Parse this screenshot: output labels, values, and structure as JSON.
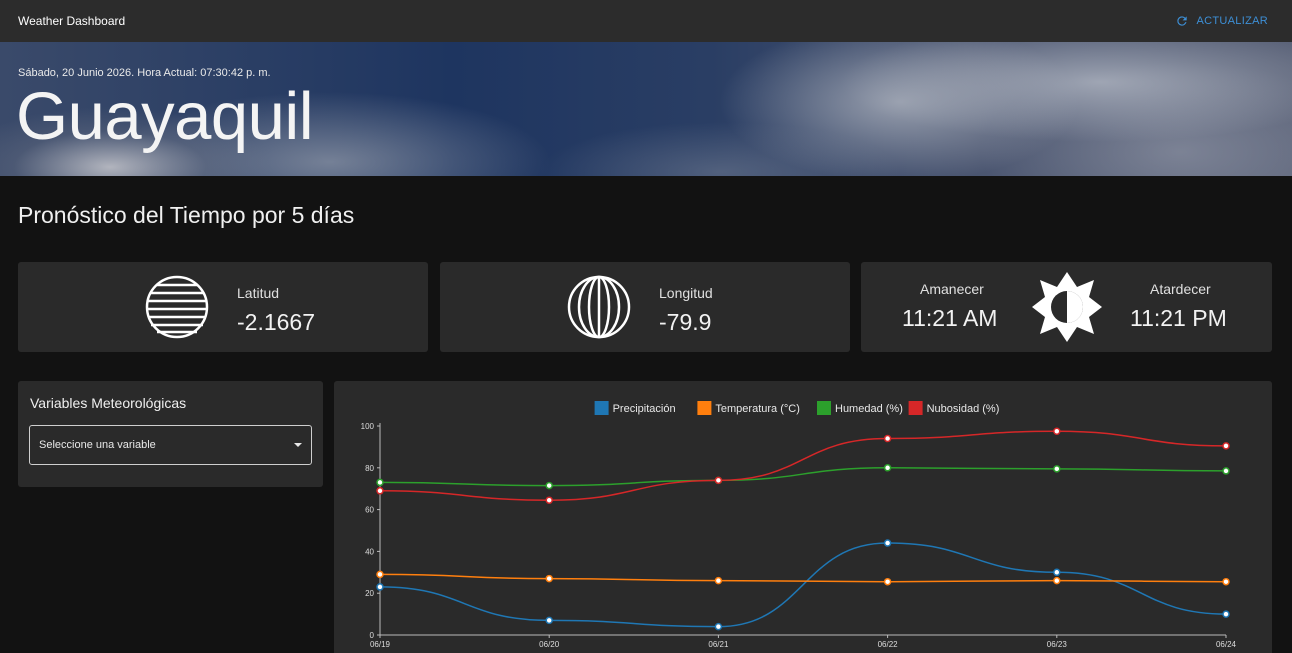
{
  "appbar": {
    "title": "Weather Dashboard",
    "refresh_label": "ACTUALIZAR"
  },
  "hero": {
    "date_line": "Sábado, 20 Junio 2026. Hora Actual: 07:30:42 p. m.",
    "city": "Guayaquil"
  },
  "section_title": "Pronóstico del Tiempo por 5 días",
  "cards": {
    "latitude": {
      "label": "Latitud",
      "value": "-2.1667"
    },
    "longitude": {
      "label": "Longitud",
      "value": "-79.9"
    },
    "sunrise": {
      "label": "Amanecer",
      "value": "11:21 AM"
    },
    "sunset": {
      "label": "Atardecer",
      "value": "11:21 PM"
    }
  },
  "variables": {
    "title": "Variables Meteorológicas",
    "select_placeholder": "Seleccione una variable"
  },
  "colors": {
    "accent": "#3d8fd6",
    "precip": "#1f77b4",
    "temp": "#ff7f0e",
    "humidity": "#2ca02c",
    "cloud": "#d62728"
  },
  "chart_data": {
    "type": "line",
    "categories": [
      "06/19",
      "06/20",
      "06/21",
      "06/22",
      "06/23",
      "06/24"
    ],
    "ylim": [
      0,
      100
    ],
    "yticks": [
      0,
      20,
      40,
      60,
      80,
      100
    ],
    "legend_position": "top",
    "series": [
      {
        "name": "Precipitación",
        "color": "#1f77b4",
        "values": [
          23,
          7,
          4,
          44,
          30,
          10
        ]
      },
      {
        "name": "Temperatura (°C)",
        "color": "#ff7f0e",
        "values": [
          29,
          27,
          26,
          25.5,
          26,
          25.5
        ]
      },
      {
        "name": "Humedad (%)",
        "color": "#2ca02c",
        "values": [
          73,
          71.5,
          74,
          80,
          79.5,
          78.5
        ]
      },
      {
        "name": "Nubosidad (%)",
        "color": "#d62728",
        "values": [
          69,
          64.5,
          74,
          94,
          97.5,
          90.5
        ]
      }
    ]
  }
}
